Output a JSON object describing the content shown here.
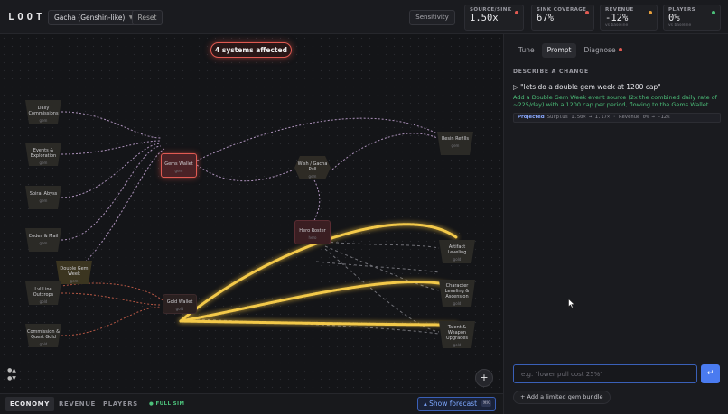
{
  "app": {
    "logo": "LOOT"
  },
  "toolbar": {
    "preset": "Gacha (Genshin-like)",
    "reset_label": "Reset",
    "sensitivity_label": "Sensitivity"
  },
  "metrics": [
    {
      "label": "SOURCE/SINK",
      "value": "1.50x",
      "sub": "",
      "dot_color": "#e05a52"
    },
    {
      "label": "SINK COVERAGE",
      "value": "67%",
      "sub": "",
      "dot_color": "#e05a52"
    },
    {
      "label": "REVENUE",
      "value": "-12%",
      "sub": "vs baseline",
      "dot_color": "#e8a03c"
    },
    {
      "label": "PLAYERS",
      "value": "0%",
      "sub": "vs baseline",
      "dot_color": "#4cc07a"
    }
  ],
  "canvas": {
    "affected_badge": "4 systems affected",
    "add_label": "+",
    "nodes": {
      "daily": {
        "label": "Daily Commissions",
        "sub": "gem"
      },
      "events": {
        "label": "Events & Exploration",
        "sub": "gem"
      },
      "abyss": {
        "label": "Spiral Abyss",
        "sub": "gem"
      },
      "codes": {
        "label": "Codes & Mail",
        "sub": "gem"
      },
      "double": {
        "label": "Double Gem Week",
        "sub": "gem"
      },
      "lvl": {
        "label": "Lvl Line Outcrops",
        "sub": "gold"
      },
      "commission": {
        "label": "Commission & Quest Gold",
        "sub": "gold"
      },
      "gems": {
        "label": "Gems Wallet",
        "sub": "gem"
      },
      "gold": {
        "label": "Gold Wallet",
        "sub": "gold"
      },
      "wish": {
        "label": "Wish / Gacha Pull",
        "sub": "gem"
      },
      "hero": {
        "label": "Hero Roster",
        "sub": "hero"
      },
      "resin": {
        "label": "Resin Refills",
        "sub": "gem"
      },
      "artifact": {
        "label": "Artifact Leveling",
        "sub": "gold"
      },
      "charlvl": {
        "label": "Character Leveling & Ascension",
        "sub": "gold"
      },
      "talent": {
        "label": "Talent & Weapon Upgrades",
        "sub": "gold"
      }
    }
  },
  "bottom": {
    "tabs": [
      "ECONOMY",
      "REVENUE",
      "PLAYERS"
    ],
    "full_sim": "FULL SIM",
    "forecast_label": "Show forecast",
    "forecast_kbd": "⌘K"
  },
  "panel": {
    "tabs": [
      "Tune",
      "Prompt",
      "Diagnose"
    ],
    "section_title": "DESCRIBE A CHANGE",
    "prompt_text": "\"lets do a double gem week at 1200 cap\"",
    "response_text": "Add a Double Gem Week event source (2x the combined daily rate of ~225/day) with a 1200 cap per period, flowing to the Gems Wallet.",
    "projected_label": "Projected",
    "projected_value": "Surplus 1.50× → 1.17× · Revenue 0% → -12%",
    "input_placeholder": "e.g. \"lower pull cost 25%\"",
    "send_icon": "↵",
    "suggestion_chip": "Add a limited gem bundle"
  }
}
